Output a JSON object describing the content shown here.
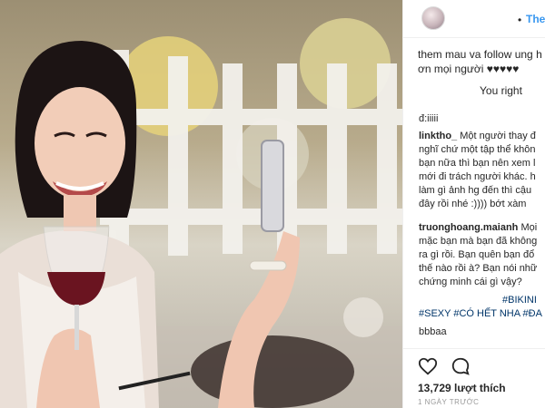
{
  "post": {
    "image_alt": "Woman smiling holding a glass of red wine and a phone",
    "header": {
      "follow_label": "Theo dõi",
      "follow_dot": "•"
    },
    "caption": {
      "line1": "them mau va follow ung h",
      "line2": "ơn mọi người ♥♥♥♥♥",
      "line3": "You right"
    },
    "comments": [
      {
        "username": "",
        "lines": [
          "đ:iiiii"
        ]
      },
      {
        "username": "linktho_",
        "lines": [
          "Một người thay đ",
          "nghĩ chứ một tập thể khôn",
          "bạn nữa thì bạn nên xem l",
          "mới đi trách người khác. h",
          "làm gì ảnh hg đến thì cậu",
          "đây rồi nhé :)))) bớt xàm"
        ]
      },
      {
        "username": "truonghoang.maianh",
        "lines": [
          "Mọi",
          "mặc bạn mà bạn đã không",
          "ra gì rồi. Bạn quên bạn đổ",
          "thế nào rồi à? Bạn nói nhữ",
          "chứng minh cái gì vậy?"
        ]
      },
      {
        "username": "",
        "lines": [
          "#BIKINI",
          "#SEXY #CÓ HẾT NHA #ĐA"
        ]
      },
      {
        "username": "",
        "lines": [
          "bbbaa"
        ]
      }
    ],
    "actions": {
      "like_icon": "heart-icon",
      "comment_icon": "comment-icon"
    },
    "likes_text": "13,729 lượt thích",
    "time_text": "1 NGÀY TRƯỚC"
  }
}
